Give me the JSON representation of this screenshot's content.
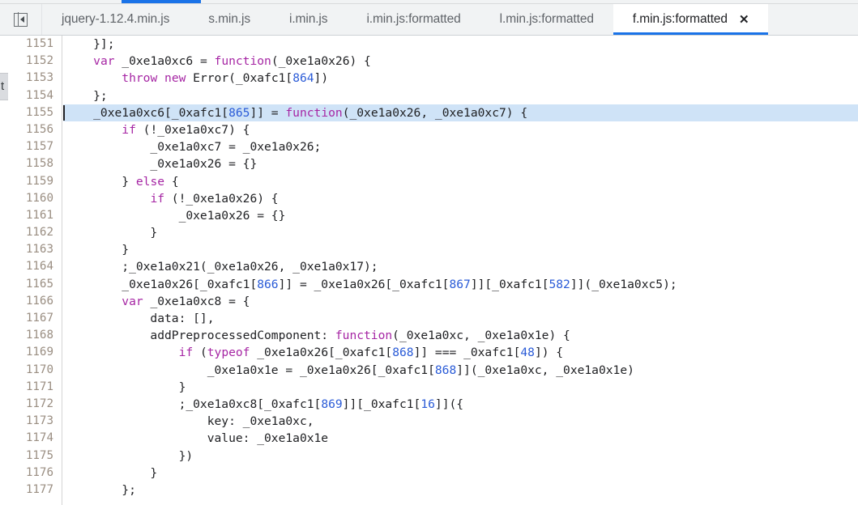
{
  "window": {
    "title": "f.min.js:formatted",
    "accent_color": "#1a73e8",
    "selection_color": "#cfe3f7"
  },
  "top_indicator": {
    "name": "horizontal-scroll-indicator",
    "fill_color": "#1a73e8"
  },
  "tabbar": {
    "toggle_icon": "panel-collapse-icon",
    "tabs": [
      {
        "label": "jquery-1.12.4.min.js",
        "active": false
      },
      {
        "label": "s.min.js",
        "active": false
      },
      {
        "label": "i.min.js",
        "active": false
      },
      {
        "label": "i.min.js:formatted",
        "active": false
      },
      {
        "label": "l.min.js:formatted",
        "active": false
      },
      {
        "label": "f.min.js:formatted",
        "active": true
      }
    ],
    "close_glyph": "✕"
  },
  "left_rail": {
    "chip_label": "t"
  },
  "editor": {
    "first_line": 1151,
    "selected_line": 1155,
    "lines": [
      {
        "n": 1151,
        "tokens": [
          {
            "t": "    }];",
            "c": "pln"
          }
        ]
      },
      {
        "n": 1152,
        "tokens": [
          {
            "t": "    ",
            "c": "pln"
          },
          {
            "t": "var",
            "c": "kw"
          },
          {
            "t": " _0xe1a0xc6 = ",
            "c": "pln"
          },
          {
            "t": "function",
            "c": "kw"
          },
          {
            "t": "(_0xe1a0x26) {",
            "c": "pln"
          }
        ]
      },
      {
        "n": 1153,
        "tokens": [
          {
            "t": "        ",
            "c": "pln"
          },
          {
            "t": "throw",
            "c": "kw"
          },
          {
            "t": " ",
            "c": "pln"
          },
          {
            "t": "new",
            "c": "kw"
          },
          {
            "t": " Error(_0xafc1[",
            "c": "pln"
          },
          {
            "t": "864",
            "c": "num"
          },
          {
            "t": "])",
            "c": "pln"
          }
        ]
      },
      {
        "n": 1154,
        "tokens": [
          {
            "t": "    };",
            "c": "pln"
          }
        ]
      },
      {
        "n": 1155,
        "tokens": [
          {
            "t": "    _0xe1a0xc6[_0xafc1[",
            "c": "pln"
          },
          {
            "t": "865",
            "c": "num"
          },
          {
            "t": "]] = ",
            "c": "pln"
          },
          {
            "t": "function",
            "c": "kw"
          },
          {
            "t": "(_0xe1a0x26, _0xe1a0xc7) {",
            "c": "pln"
          }
        ]
      },
      {
        "n": 1156,
        "tokens": [
          {
            "t": "        ",
            "c": "pln"
          },
          {
            "t": "if",
            "c": "kw"
          },
          {
            "t": " (!_0xe1a0xc7) {",
            "c": "pln"
          }
        ]
      },
      {
        "n": 1157,
        "tokens": [
          {
            "t": "            _0xe1a0xc7 = _0xe1a0x26;",
            "c": "pln"
          }
        ]
      },
      {
        "n": 1158,
        "tokens": [
          {
            "t": "            _0xe1a0x26 = {}",
            "c": "pln"
          }
        ]
      },
      {
        "n": 1159,
        "tokens": [
          {
            "t": "        } ",
            "c": "pln"
          },
          {
            "t": "else",
            "c": "kw"
          },
          {
            "t": " {",
            "c": "pln"
          }
        ]
      },
      {
        "n": 1160,
        "tokens": [
          {
            "t": "            ",
            "c": "pln"
          },
          {
            "t": "if",
            "c": "kw"
          },
          {
            "t": " (!_0xe1a0x26) {",
            "c": "pln"
          }
        ]
      },
      {
        "n": 1161,
        "tokens": [
          {
            "t": "                _0xe1a0x26 = {}",
            "c": "pln"
          }
        ]
      },
      {
        "n": 1162,
        "tokens": [
          {
            "t": "            }",
            "c": "pln"
          }
        ]
      },
      {
        "n": 1163,
        "tokens": [
          {
            "t": "        }",
            "c": "pln"
          }
        ]
      },
      {
        "n": 1164,
        "tokens": [
          {
            "t": "        ;_0xe1a0x21(_0xe1a0x26, _0xe1a0x17);",
            "c": "pln"
          }
        ]
      },
      {
        "n": 1165,
        "tokens": [
          {
            "t": "        _0xe1a0x26[_0xafc1[",
            "c": "pln"
          },
          {
            "t": "866",
            "c": "num"
          },
          {
            "t": "]] = _0xe1a0x26[_0xafc1[",
            "c": "pln"
          },
          {
            "t": "867",
            "c": "num"
          },
          {
            "t": "]][_0xafc1[",
            "c": "pln"
          },
          {
            "t": "582",
            "c": "num"
          },
          {
            "t": "]](_0xe1a0xc5);",
            "c": "pln"
          }
        ]
      },
      {
        "n": 1166,
        "tokens": [
          {
            "t": "        ",
            "c": "pln"
          },
          {
            "t": "var",
            "c": "kw"
          },
          {
            "t": " _0xe1a0xc8 = {",
            "c": "pln"
          }
        ]
      },
      {
        "n": 1167,
        "tokens": [
          {
            "t": "            data: [],",
            "c": "pln"
          }
        ]
      },
      {
        "n": 1168,
        "tokens": [
          {
            "t": "            addPreprocessedComponent: ",
            "c": "pln"
          },
          {
            "t": "function",
            "c": "kw"
          },
          {
            "t": "(_0xe1a0xc, _0xe1a0x1e) {",
            "c": "pln"
          }
        ]
      },
      {
        "n": 1169,
        "tokens": [
          {
            "t": "                ",
            "c": "pln"
          },
          {
            "t": "if",
            "c": "kw"
          },
          {
            "t": " (",
            "c": "pln"
          },
          {
            "t": "typeof",
            "c": "kw"
          },
          {
            "t": " _0xe1a0x26[_0xafc1[",
            "c": "pln"
          },
          {
            "t": "868",
            "c": "num"
          },
          {
            "t": "]] === _0xafc1[",
            "c": "pln"
          },
          {
            "t": "48",
            "c": "num"
          },
          {
            "t": "]) {",
            "c": "pln"
          }
        ]
      },
      {
        "n": 1170,
        "tokens": [
          {
            "t": "                    _0xe1a0x1e = _0xe1a0x26[_0xafc1[",
            "c": "pln"
          },
          {
            "t": "868",
            "c": "num"
          },
          {
            "t": "]](_0xe1a0xc, _0xe1a0x1e)",
            "c": "pln"
          }
        ]
      },
      {
        "n": 1171,
        "tokens": [
          {
            "t": "                }",
            "c": "pln"
          }
        ]
      },
      {
        "n": 1172,
        "tokens": [
          {
            "t": "                ;_0xe1a0xc8[_0xafc1[",
            "c": "pln"
          },
          {
            "t": "869",
            "c": "num"
          },
          {
            "t": "]][_0xafc1[",
            "c": "pln"
          },
          {
            "t": "16",
            "c": "num"
          },
          {
            "t": "]]({",
            "c": "pln"
          }
        ]
      },
      {
        "n": 1173,
        "tokens": [
          {
            "t": "                    key: _0xe1a0xc,",
            "c": "pln"
          }
        ]
      },
      {
        "n": 1174,
        "tokens": [
          {
            "t": "                    value: _0xe1a0x1e",
            "c": "pln"
          }
        ]
      },
      {
        "n": 1175,
        "tokens": [
          {
            "t": "                })",
            "c": "pln"
          }
        ]
      },
      {
        "n": 1176,
        "tokens": [
          {
            "t": "            }",
            "c": "pln"
          }
        ]
      },
      {
        "n": 1177,
        "tokens": [
          {
            "t": "        };",
            "c": "pln"
          }
        ]
      }
    ]
  }
}
